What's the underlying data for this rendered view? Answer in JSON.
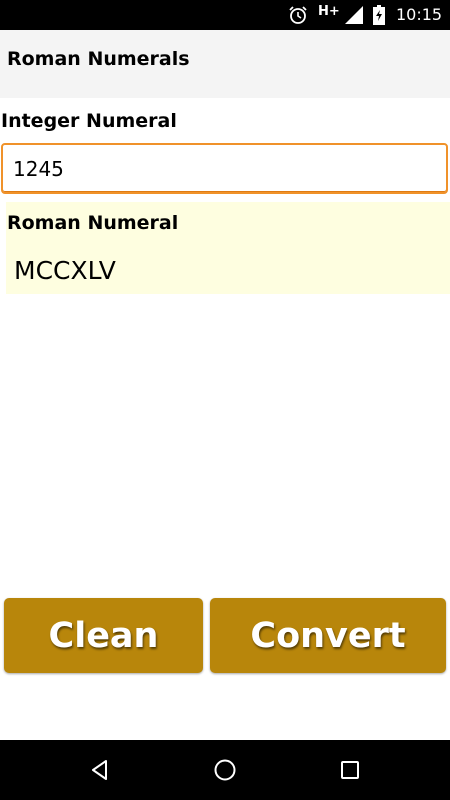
{
  "status_bar": {
    "time": "10:15",
    "network": "H+",
    "icons": [
      "alarm-icon",
      "signal-icon",
      "battery-charging-icon"
    ]
  },
  "app_bar": {
    "title": "Roman Numerals"
  },
  "form": {
    "integer_label": "Integer Numeral",
    "integer_value": "1245",
    "roman_label": "Roman Numeral",
    "roman_value": "MCCXLV"
  },
  "buttons": {
    "clean_label": "Clean",
    "convert_label": "Convert"
  },
  "nav_bar": {
    "icons": [
      "back-icon",
      "home-icon",
      "recents-icon"
    ]
  },
  "colors": {
    "accent": "#f0922a",
    "button": "#b8860b",
    "result_background": "#fefee0",
    "app_bar": "#f4f4f4"
  }
}
